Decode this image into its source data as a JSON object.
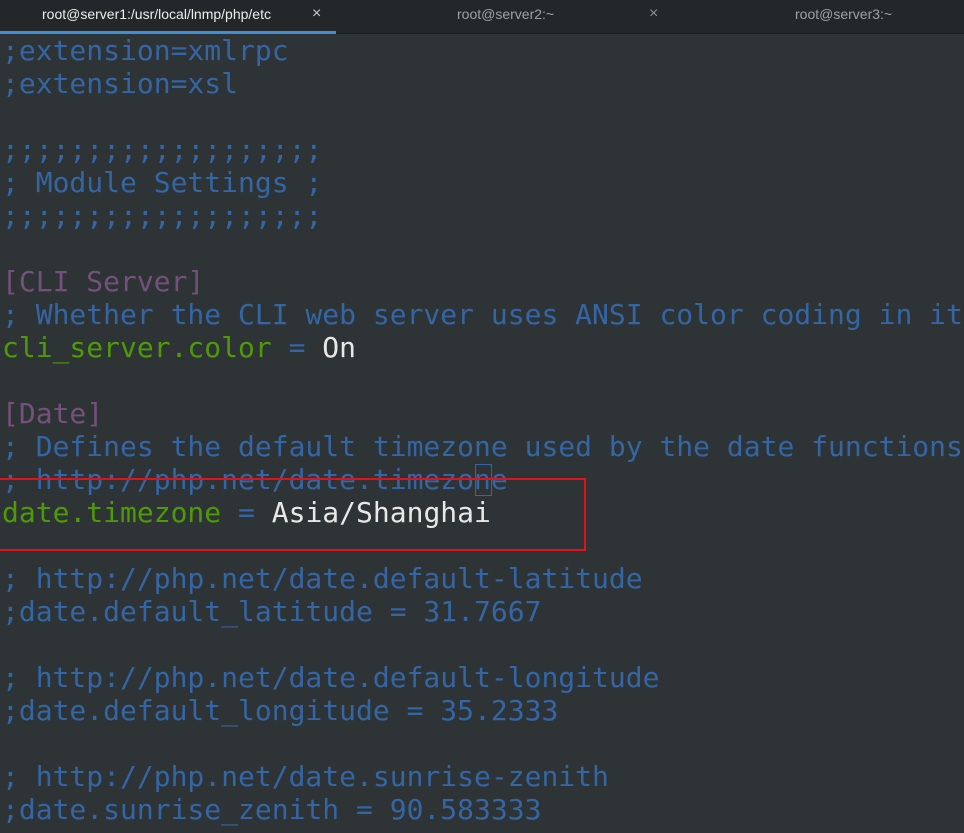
{
  "tabs": [
    {
      "label": "root@server1:/usr/local/lnmp/php/etc",
      "active": true,
      "close": "×"
    },
    {
      "label": "root@server2:~",
      "active": false,
      "close": "×"
    },
    {
      "label": "root@server3:~",
      "active": false
    }
  ],
  "colors": {
    "background": "#2e3436",
    "comment": "#3465a4",
    "section": "#75507b",
    "key": "#4e9a06",
    "value": "#e8e8e6",
    "highlight": "#e3111b",
    "tab_indicator": "#3d8fd8"
  },
  "lines": [
    {
      "comment": ";extension=xmlrpc"
    },
    {
      "comment": ";extension=xsl"
    },
    {
      "comment": ""
    },
    {
      "comment": ";;;;;;;;;;;;;;;;;;;"
    },
    {
      "comment": "; Module Settings ;"
    },
    {
      "comment": ";;;;;;;;;;;;;;;;;;;"
    },
    {
      "comment": ""
    },
    {
      "section": "[CLI Server]"
    },
    {
      "comment": "; Whether the CLI web server uses ANSI color coding in its"
    },
    {
      "key": "cli_server.color",
      "op": " = ",
      "value": "On"
    },
    {
      "comment": ""
    },
    {
      "section": "[Date]"
    },
    {
      "comment": "; Defines the default timezone used by the date functions"
    },
    {
      "comment": "; http://php.net/date.timezone"
    },
    {
      "key": "date.timezone",
      "op": " = ",
      "value": "Asia/Shanghai"
    },
    {
      "comment": ""
    },
    {
      "comment": "; http://php.net/date.default-latitude"
    },
    {
      "comment": ";date.default_latitude = 31.7667"
    },
    {
      "comment": ""
    },
    {
      "comment": "; http://php.net/date.default-longitude"
    },
    {
      "comment": ";date.default_longitude = 35.2333"
    },
    {
      "comment": ""
    },
    {
      "comment": "; http://php.net/date.sunrise-zenith"
    },
    {
      "comment": ";date.sunrise_zenith = 90.583333"
    }
  ]
}
